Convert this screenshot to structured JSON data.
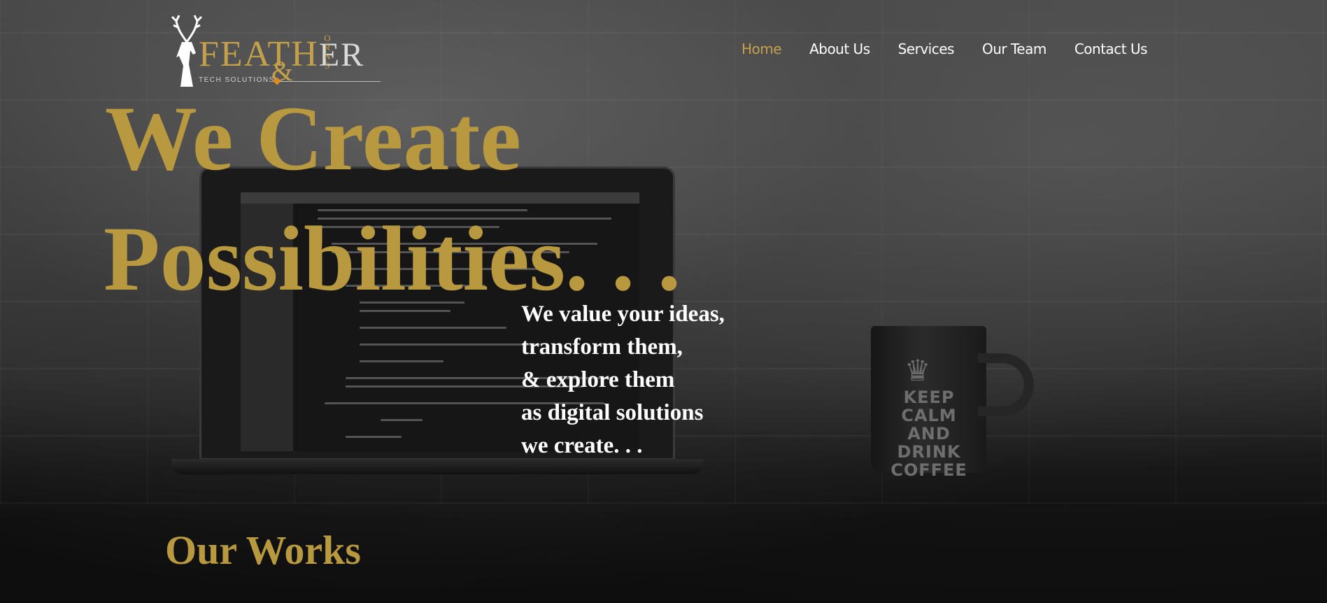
{
  "logo": {
    "word_left": "FEAT",
    "word_mid": "H",
    "word_right": "ER",
    "amp": "&",
    "horns": "ORNS",
    "tagline": "TECH SOLUTIONS"
  },
  "nav": {
    "items": [
      {
        "label": "Home",
        "active": true
      },
      {
        "label": "About Us",
        "active": false
      },
      {
        "label": "Services",
        "active": false
      },
      {
        "label": "Our Team",
        "active": false
      },
      {
        "label": "Contact Us",
        "active": false
      }
    ]
  },
  "hero": {
    "headline_line1": "We Create",
    "headline_line2": "Possibilities. . .",
    "tagline_lines": [
      "We value your ideas,",
      "transform them,",
      "& explore them",
      "as digital solutions",
      "we create. . ."
    ],
    "mug_text": "KEEP CALM AND DRINK COFFEE"
  },
  "works": {
    "title": "Our Works"
  },
  "colors": {
    "accent_gold": "#b8993f",
    "nav_active": "#c4a04c",
    "background": "#0e0e0e"
  }
}
